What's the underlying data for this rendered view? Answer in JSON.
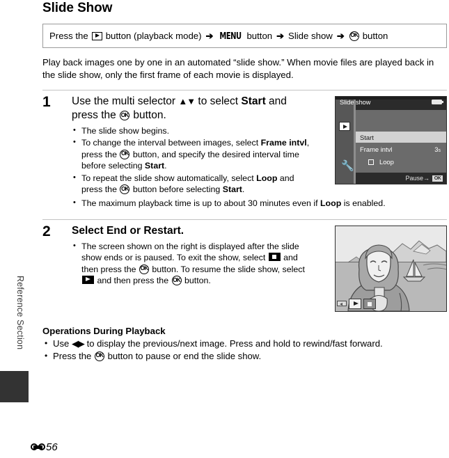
{
  "page": {
    "title": "Slide Show",
    "footer_number": "56",
    "footer_symbol": "reference-section-symbol",
    "side_rail_label": "Reference Section"
  },
  "nav_path": {
    "prefix": "Press the",
    "icon1": "playback-button-icon",
    "mid1": "button (playback mode)",
    "arrow": "➔",
    "menu_label": "MENU",
    "mid2": "button",
    "item": "Slide show",
    "ok_icon": "ok-button-icon",
    "suffix": "button"
  },
  "intro": "Play back images one by one in an automated “slide show.” When movie files are played back in the slide show, only the first frame of each movie is displayed.",
  "steps": [
    {
      "number": "1",
      "heading_part1": "Use the multi selector ",
      "heading_arrows": "▲▼",
      "heading_part2": " to select ",
      "heading_bold": "Start",
      "heading_part3": " and press the ",
      "heading_part4": " button.",
      "bullets": [
        "The slide show begins.",
        "To change the interval between images, select Frame intvl, press the OK button, and specify the desired interval time before selecting Start.",
        "To repeat the slide show automatically, select Loop and press the OK button before selecting Start.",
        "The maximum playback time is up to about 30 minutes even if Loop is enabled."
      ]
    },
    {
      "number": "2",
      "heading": "Select End or Restart.",
      "bullets": [
        "The screen shown on the right is displayed after the slide show ends or is paused. To exit the show, select (stop) and then press the OK button. To resume the slide show, select (play) and then press the OK button."
      ]
    }
  ],
  "lcd": {
    "title": "Slide show",
    "battery_icon": "battery-full-icon",
    "sidebar": {
      "playback_icon": "playback-tab-icon",
      "setup_icon": "wrench-setup-tab-icon"
    },
    "rows": [
      {
        "label": "Start",
        "value": "",
        "selected": true
      },
      {
        "label": "Frame intvl",
        "value": "3",
        "value_unit": "s",
        "selected": false
      }
    ],
    "checkbox": {
      "label": "Loop",
      "checked": false
    },
    "bottom_hint": "Pause→",
    "bottom_badge": "OK"
  },
  "photo": {
    "alt": "woman-with-sailboat-seascape-illustration",
    "controls": [
      {
        "name": "rewind-indicator",
        "state": "small"
      },
      {
        "name": "play-button",
        "state": "light"
      },
      {
        "name": "stop-button",
        "state": "dark"
      }
    ]
  },
  "operations": {
    "title": "Operations During Playback",
    "bullets": [
      {
        "pre": "Use ",
        "icon": "◀▶",
        "post": " to display the previous/next image. Press and hold to rewind/fast forward."
      },
      {
        "pre": "Press the ",
        "icon": "ok-button-icon",
        "post": " button to pause or end the slide show."
      }
    ]
  },
  "colors": {
    "lcd_bg": "#6b6b6b",
    "lcd_bar": "#2b2b2b",
    "lcd_selected": "#d2d2d2",
    "rule": "#c3c3c3",
    "tab": "#333333"
  }
}
